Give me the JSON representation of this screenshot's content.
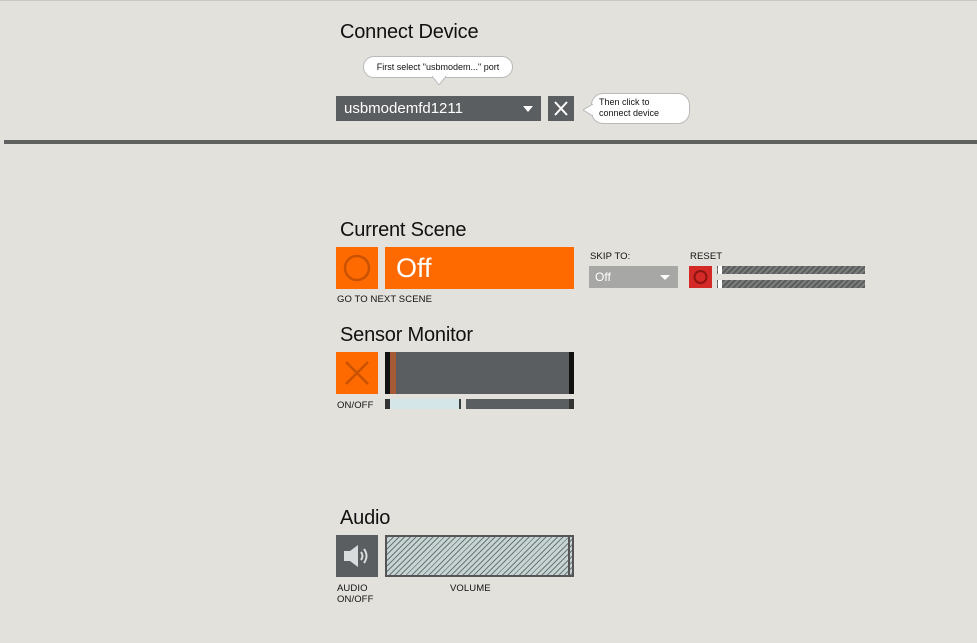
{
  "connect": {
    "title": "Connect Device",
    "port_tooltip": "First select \"usbmodem...\" port",
    "port_value": "usbmodemfd1211",
    "connect_tooltip_line1": "Then click to",
    "connect_tooltip_line2": "connect device"
  },
  "scene": {
    "title": "Current Scene",
    "display_value": "Off",
    "next_label": "GO TO NEXT SCENE",
    "skip_label": "SKIP TO:",
    "skip_value": "Off",
    "reset_label": "RESET"
  },
  "sensor": {
    "title": "Sensor Monitor",
    "toggle_label": "ON/OFF"
  },
  "audio": {
    "title": "Audio",
    "toggle_label_line1": "AUDIO",
    "toggle_label_line2": "ON/OFF",
    "volume_label": "VOLUME"
  },
  "icons": {
    "scene_button": "circle-icon",
    "connect_button": "close-icon",
    "sensor_toggle": "close-icon",
    "reset_button": "circle-icon",
    "audio_toggle": "speaker-icon"
  },
  "colors": {
    "accent": "#ff6a00",
    "control": "#5b5e60",
    "reset": "#d42a27",
    "background": "#e2e1dc"
  }
}
